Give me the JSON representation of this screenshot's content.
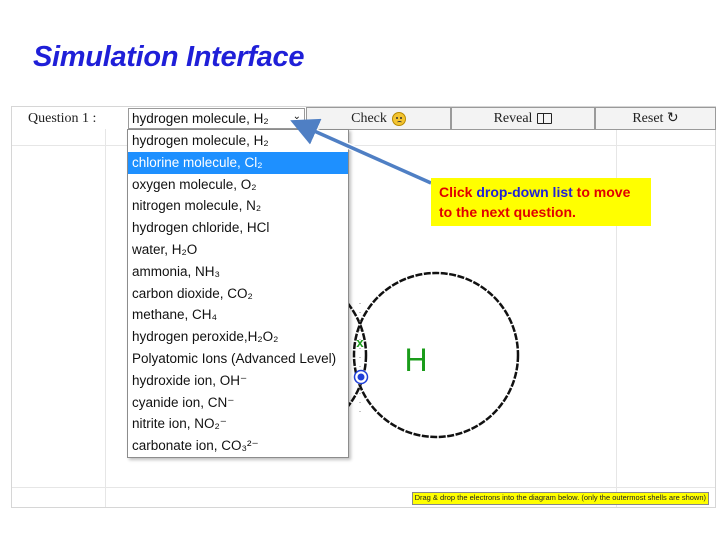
{
  "slide": {
    "title": "Simulation Interface"
  },
  "toolbar": {
    "question_label": "Question 1 :",
    "selected_value": "hydrogen molecule, H₂",
    "check_label": "Check",
    "reveal_label": "Reveal",
    "reset_label": "Reset ↻"
  },
  "dropdown": {
    "options": [
      "hydrogen molecule, H₂",
      "chlorine molecule, Cl₂",
      "oxygen molecule, O₂",
      "nitrogen molecule, N₂",
      "hydrogen chloride, HCl",
      "water, H₂O",
      "ammonia, NH₃",
      "carbon dioxide, CO₂",
      "methane, CH₄",
      "hydrogen peroxide,H₂O₂",
      "Polyatomic Ions (Advanced Level)",
      "hydroxide ion, OH⁻",
      "cyanide ion, CN⁻",
      "nitrite ion, NO₂⁻",
      "carbonate ion, CO₃²⁻"
    ],
    "highlighted_index": 1
  },
  "diagram": {
    "atom_symbol": "H",
    "electron_cross": "x"
  },
  "footer": {
    "note": "Drag & drop the electrons into the diagram below. (only the outermost shells are shown)"
  },
  "callout": {
    "part1": "Click ",
    "highlight": "drop-down list",
    "part2": " to move to the next question."
  },
  "colors": {
    "title": "#1f1fd8",
    "callout_bg": "#ffff00",
    "callout_text": "#e00000",
    "selected_option": "#1e90ff",
    "atom_symbol": "#1a9c1a",
    "electron": "#1f3fd8"
  }
}
